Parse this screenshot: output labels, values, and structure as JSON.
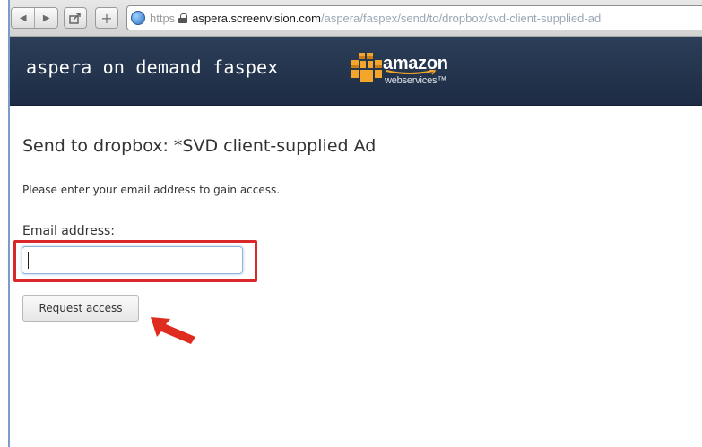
{
  "browser": {
    "url_scheme": "https",
    "url_host": "aspera.screenvision.com",
    "url_path": "/aspera/faspex/send/to/dropbox/svd-client-supplied-ad",
    "icons": [
      "back-icon",
      "forward-icon",
      "share-icon",
      "add-icon",
      "globe-icon",
      "lock-icon"
    ]
  },
  "header": {
    "title": "aspera on demand faspex",
    "logo_word": "amazon",
    "logo_sub": "webservices™"
  },
  "main": {
    "page_title": "Send to dropbox: *SVD client-supplied Ad",
    "instructions": "Please enter your email address to gain access.",
    "email_label": "Email address:",
    "email_value": "",
    "submit_label": "Request access"
  },
  "colors": {
    "header_bg": "#22324c",
    "highlight": "#d8282a",
    "annotation_arrow": "#e02b1f"
  }
}
